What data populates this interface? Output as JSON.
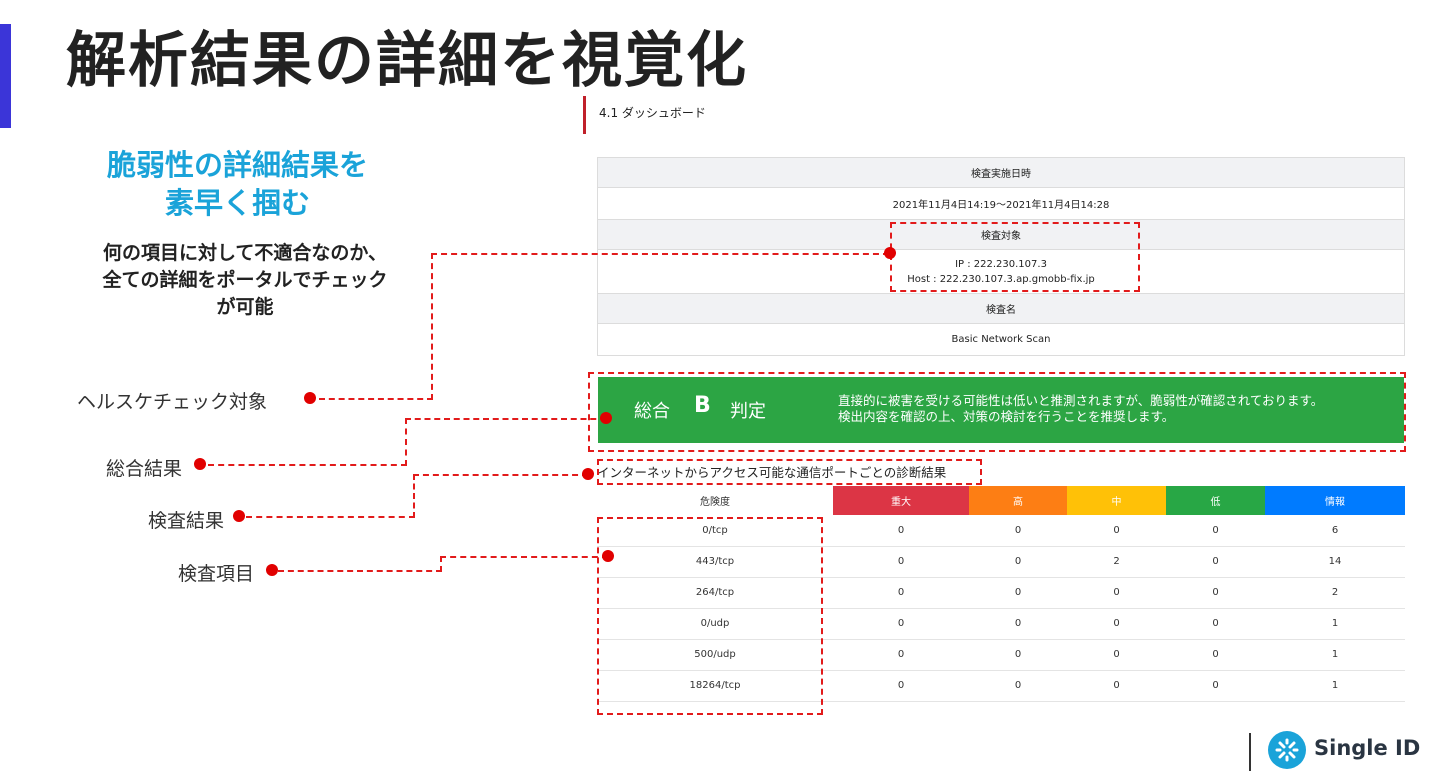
{
  "slide": {
    "title": "解析結果の詳細を視覚化",
    "headline_line1": "脆弱性の詳細結果を",
    "headline_line2": "素早く掴む",
    "description_line1": "何の項目に対して不適合なのか、",
    "description_line2": "全ての詳細をポータルでチェック",
    "description_line3": "が可能"
  },
  "callouts": {
    "health_check_target": "ヘルスケチェック対象",
    "overall_result": "総合結果",
    "check_result": "検査結果",
    "check_items": "検査項目"
  },
  "dashboard": {
    "section_title": "4.1 ダッシュボード",
    "info": {
      "date_header": "検査実施日時",
      "date_value": "2021年11月4日14:19～2021年11月4日14:28",
      "target_header": "検査対象",
      "target_ip": "IP : 222.230.107.3",
      "target_host": "Host : 222.230.107.3.ap.gmobb-fix.jp",
      "name_header": "検査名",
      "name_value": "Basic Network Scan"
    },
    "overall": {
      "label": "総合",
      "grade": "B",
      "suffix": "判定",
      "message_line1": "直接的に被害を受ける可能性は低いと推測されますが、脆弱性が確認されております。",
      "message_line2": "検出内容を確認の上、対策の検討を行うことを推奨します。",
      "color": "#2ca544"
    },
    "ports_heading": "インターネットからアクセス可能な通信ポートごとの診断結果",
    "severity_columns": [
      {
        "label": "重大",
        "color": "#dc3545"
      },
      {
        "label": "高",
        "color": "#fd7e14"
      },
      {
        "label": "中",
        "color": "#ffc107"
      },
      {
        "label": "低",
        "color": "#28a745"
      },
      {
        "label": "情報",
        "color": "#007bff"
      }
    ],
    "severity_header": "危険度",
    "rows": [
      {
        "port": "0/tcp",
        "values": [
          "0",
          "0",
          "0",
          "0",
          "6"
        ]
      },
      {
        "port": "443/tcp",
        "values": [
          "0",
          "0",
          "2",
          "0",
          "14"
        ]
      },
      {
        "port": "264/tcp",
        "values": [
          "0",
          "0",
          "0",
          "0",
          "2"
        ]
      },
      {
        "port": "0/udp",
        "values": [
          "0",
          "0",
          "0",
          "0",
          "1"
        ]
      },
      {
        "port": "500/udp",
        "values": [
          "0",
          "0",
          "0",
          "0",
          "1"
        ]
      },
      {
        "port": "18264/tcp",
        "values": [
          "0",
          "0",
          "0",
          "0",
          "1"
        ]
      }
    ]
  },
  "brand": {
    "name": "Single ID",
    "icon": "single-id-logo-icon"
  }
}
